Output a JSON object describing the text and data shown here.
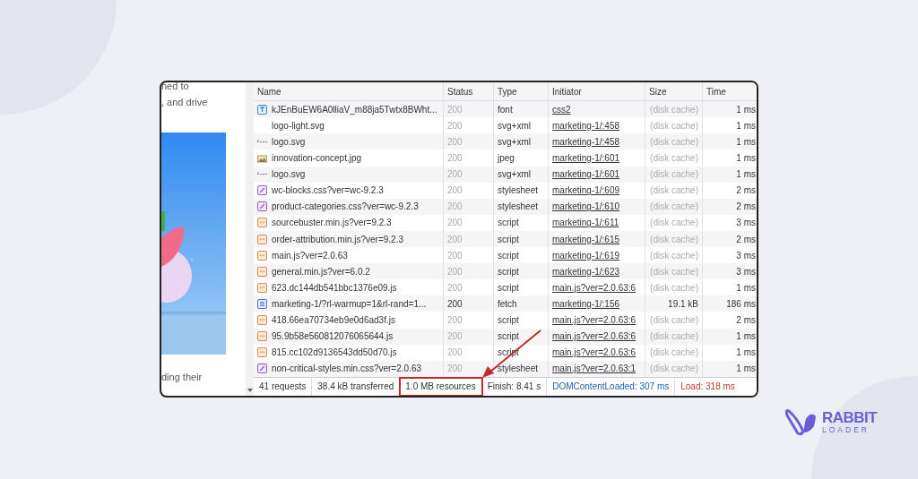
{
  "page_fragment": {
    "texts": [
      "ned to",
      ", and drive",
      "ding their"
    ]
  },
  "table": {
    "columns": [
      "Name",
      "Status",
      "Type",
      "Initiator",
      "Size",
      "Time"
    ],
    "rows": [
      {
        "kind": "glyph",
        "name": "kJEnBuEW6A0lliaV_m88ja5Twtx8BWht...",
        "status": "200",
        "type": "font",
        "initiator": "css2",
        "size": "(disk cache)",
        "time": "1 ms",
        "cached": true
      },
      {
        "kind": "blank",
        "name": "logo-light.svg",
        "status": "200",
        "type": "svg+xml",
        "initiator": "marketing-1/:458",
        "size": "(disk cache)",
        "time": "1 ms",
        "cached": true
      },
      {
        "kind": "vector",
        "name": "logo.svg",
        "status": "200",
        "type": "svg+xml",
        "initiator": "marketing-1/:458",
        "size": "(disk cache)",
        "time": "1 ms",
        "cached": true
      },
      {
        "name": "innovation-concept.jpg",
        "status": "200",
        "type": "jpeg",
        "initiator": "marketing-1/:601",
        "size": "(disk cache)",
        "time": "1 ms",
        "cached": true
      },
      {
        "kind": "vector",
        "name": "logo.svg",
        "status": "200",
        "type": "svg+xml",
        "initiator": "marketing-1/:601",
        "size": "(disk cache)",
        "time": "1 ms",
        "cached": true
      },
      {
        "kind": "css",
        "name": "wc-blocks.css?ver=wc-9.2.3",
        "status": "200",
        "type": "stylesheet",
        "initiator": "marketing-1/:609",
        "size": "(disk cache)",
        "time": "2 ms",
        "cached": true
      },
      {
        "kind": "css",
        "name": "product-categories.css?ver=wc-9.2.3",
        "status": "200",
        "type": "stylesheet",
        "initiator": "marketing-1/:610",
        "size": "(disk cache)",
        "time": "2 ms",
        "cached": true
      },
      {
        "kind": "js",
        "name": "sourcebuster.min.js?ver=9.2.3",
        "status": "200",
        "type": "script",
        "initiator": "marketing-1/:611",
        "size": "(disk cache)",
        "time": "3 ms",
        "cached": true
      },
      {
        "kind": "js",
        "name": "order-attribution.min.js?ver=9.2.3",
        "status": "200",
        "type": "script",
        "initiator": "marketing-1/:615",
        "size": "(disk cache)",
        "time": "2 ms",
        "cached": true
      },
      {
        "kind": "js",
        "name": "main.js?ver=2.0.63",
        "status": "200",
        "type": "script",
        "initiator": "marketing-1/:619",
        "size": "(disk cache)",
        "time": "3 ms",
        "cached": true
      },
      {
        "kind": "js",
        "name": "general.min.js?ver=6.0.2",
        "status": "200",
        "type": "script",
        "initiator": "marketing-1/:623",
        "size": "(disk cache)",
        "time": "3 ms",
        "cached": true
      },
      {
        "kind": "js",
        "name": "623.dc144db541bbc1376e09.js",
        "status": "200",
        "type": "script",
        "initiator": "main.js?ver=2.0.63:6",
        "size": "(disk cache)",
        "time": "1 ms",
        "cached": true
      },
      {
        "kind": "doc",
        "name": "marketing-1/?rl-warmup=1&rl-rand=1...",
        "status": "200",
        "type": "fetch",
        "initiator": "marketing-1/:156",
        "size": "19.1 kB",
        "time": "186 ms",
        "cached": false
      },
      {
        "kind": "js",
        "name": "418.66ea70734eb9e0d6ad3f.js",
        "status": "200",
        "type": "script",
        "initiator": "main.js?ver=2.0.63:6",
        "size": "(disk cache)",
        "time": "2 ms",
        "cached": true
      },
      {
        "kind": "js",
        "name": "95.9b58e560812076065644.js",
        "status": "200",
        "type": "script",
        "initiator": "main.js?ver=2.0.63:6",
        "size": "(disk cache)",
        "time": "1 ms",
        "cached": true
      },
      {
        "kind": "js",
        "name": "815.cc102d9136543dd50d70.js",
        "status": "200",
        "type": "script",
        "initiator": "main.js?ver=2.0.63:6",
        "size": "(disk cache)",
        "time": "1 ms",
        "cached": true
      },
      {
        "kind": "css",
        "name": "non-critical-styles.min.css?ver=2.0.63",
        "status": "200",
        "type": "stylesheet",
        "initiator": "main.js?ver=2.0.63:1",
        "size": "(disk cache)",
        "time": "1 ms",
        "cached": true
      }
    ]
  },
  "status_bar": [
    {
      "text": "41 requests",
      "color": "#333333",
      "highlighted": false
    },
    {
      "text": "38.4 kB transferred",
      "color": "#333333",
      "highlighted": false
    },
    {
      "text": "1.0 MB resources",
      "color": "#333333",
      "highlighted": true
    },
    {
      "text": "Finish: 8.41 s",
      "color": "#333333",
      "highlighted": false
    },
    {
      "text": "DOMContentLoaded: 307 ms",
      "color": "#1a5fb4",
      "highlighted": false
    },
    {
      "text": "Load: 318 ms",
      "color": "#c0392b",
      "highlighted": false
    }
  ],
  "logo": {
    "line1": "RABBIT",
    "line2": "LOADER"
  }
}
